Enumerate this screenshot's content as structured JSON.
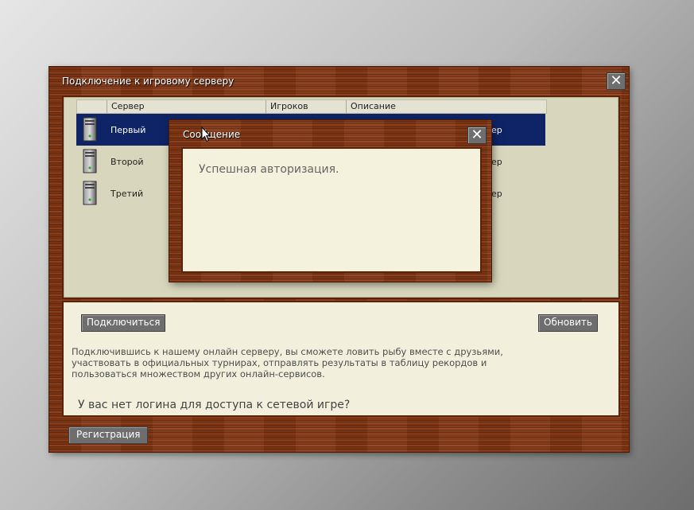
{
  "main_window": {
    "title": "Подключение к игровому серверу",
    "close_label": "✕"
  },
  "table": {
    "headers": [
      "Сервер",
      "Игроков",
      "Описание"
    ],
    "rows": [
      {
        "name": "Первый",
        "players": "",
        "description": "ер",
        "selected": true,
        "icon": "server-tower-icon"
      },
      {
        "name": "Второй",
        "players": "",
        "description": "ер",
        "selected": false,
        "icon": "server-tower-icon"
      },
      {
        "name": "Третий",
        "players": "",
        "description": "ер",
        "selected": false,
        "icon": "server-tower-icon"
      }
    ]
  },
  "buttons": {
    "connect": "Подключиться",
    "refresh": "Обновить",
    "register": "Регистрация"
  },
  "info_text": "Подключившись к нашему онлайн серверу, вы сможете ловить рыбу вместе с друзьями, участвовать в официальных турнирах, отправлять результаты в таблицу рекордов и пользоваться множеством других онлайн-сервисов.",
  "no_login_text": "У вас нет логина для доступа к сетевой игре?",
  "message_dialog": {
    "title": "Сообщение",
    "close_label": "✕",
    "text": "Успешная авторизация."
  },
  "colors": {
    "wood": "#8a3a16",
    "panel": "#d8d7bd",
    "selected_row": "#0f2466",
    "button": "#6e6e6e"
  }
}
